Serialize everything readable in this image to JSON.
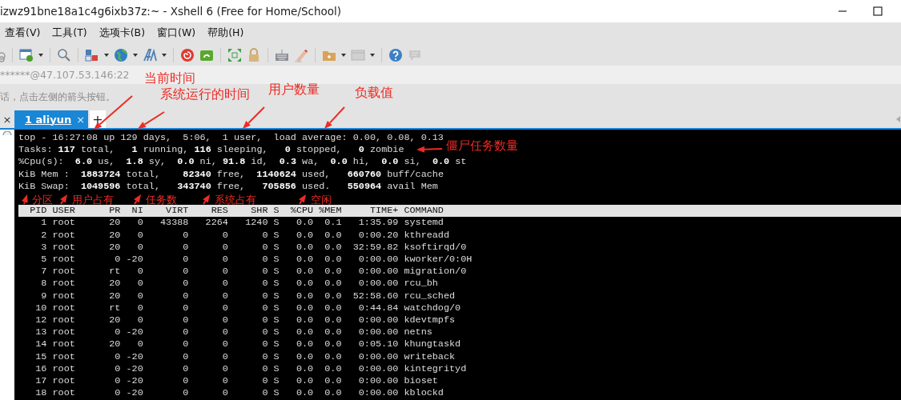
{
  "window": {
    "title": "izwz91bne18a1c4g6ixb37z:~ - Xshell 6 (Free for Home/School)"
  },
  "menu": [
    {
      "label": "查看(V)"
    },
    {
      "label": "工具(T)"
    },
    {
      "label": "选项卡(B)"
    },
    {
      "label": "窗口(W)"
    },
    {
      "label": "帮助(H)"
    }
  ],
  "address_bar": {
    "value": "******@47.107.53.146:22"
  },
  "hint_bar": {
    "text": "话，点击左侧的箭头按钮。"
  },
  "tabs": {
    "leading_close": "×",
    "items": [
      {
        "label": "1 aliyun",
        "selected": true,
        "close": "×"
      }
    ],
    "add": "+"
  },
  "terminal": {
    "summary": [
      "top - 16:27:08 up 129 days,  5:06,  1 user,  load average: 0.00, 0.08, 0.13",
      "Tasks: **117** total,   **1** running, **116** sleeping,   **0** stopped,   **0** zombie",
      "%Cpu(s):  **6.0** us,  **1.8** sy,  **0.0** ni, **91.8** id,  **0.3** wa,  **0.0** hi,  **0.0** si,  **0.0** st",
      "KiB Mem :  **1883724** total,    **82340** free,  **1140624** used,   **660760** buff/cache",
      "KiB Swap:  **1049596** total,   **343740** free,   **705856** used.   **550964** avail Mem"
    ],
    "columns": [
      "PID",
      "USER",
      "PR",
      "NI",
      "VIRT",
      "RES",
      "SHR",
      "S",
      "%CPU",
      "%MEM",
      "TIME+",
      "COMMAND"
    ],
    "rows": [
      [
        "1",
        "root",
        "20",
        "0",
        "43388",
        "2264",
        "1240",
        "S",
        "0.0",
        "0.1",
        "1:35.99",
        "systemd"
      ],
      [
        "2",
        "root",
        "20",
        "0",
        "0",
        "0",
        "0",
        "S",
        "0.0",
        "0.0",
        "0:00.20",
        "kthreadd"
      ],
      [
        "3",
        "root",
        "20",
        "0",
        "0",
        "0",
        "0",
        "S",
        "0.0",
        "0.0",
        "32:59.82",
        "ksoftirqd/0"
      ],
      [
        "5",
        "root",
        "0",
        "-20",
        "0",
        "0",
        "0",
        "S",
        "0.0",
        "0.0",
        "0:00.00",
        "kworker/0:0H"
      ],
      [
        "7",
        "root",
        "rt",
        "0",
        "0",
        "0",
        "0",
        "S",
        "0.0",
        "0.0",
        "0:00.00",
        "migration/0"
      ],
      [
        "8",
        "root",
        "20",
        "0",
        "0",
        "0",
        "0",
        "S",
        "0.0",
        "0.0",
        "0:00.00",
        "rcu_bh"
      ],
      [
        "9",
        "root",
        "20",
        "0",
        "0",
        "0",
        "0",
        "S",
        "0.0",
        "0.0",
        "52:58.60",
        "rcu_sched"
      ],
      [
        "10",
        "root",
        "rt",
        "0",
        "0",
        "0",
        "0",
        "S",
        "0.0",
        "0.0",
        "0:44.84",
        "watchdog/0"
      ],
      [
        "12",
        "root",
        "20",
        "0",
        "0",
        "0",
        "0",
        "S",
        "0.0",
        "0.0",
        "0:00.00",
        "kdevtmpfs"
      ],
      [
        "13",
        "root",
        "0",
        "-20",
        "0",
        "0",
        "0",
        "S",
        "0.0",
        "0.0",
        "0:00.00",
        "netns"
      ],
      [
        "14",
        "root",
        "20",
        "0",
        "0",
        "0",
        "0",
        "S",
        "0.0",
        "0.0",
        "0:05.10",
        "khungtaskd"
      ],
      [
        "15",
        "root",
        "0",
        "-20",
        "0",
        "0",
        "0",
        "S",
        "0.0",
        "0.0",
        "0:00.00",
        "writeback"
      ],
      [
        "16",
        "root",
        "0",
        "-20",
        "0",
        "0",
        "0",
        "S",
        "0.0",
        "0.0",
        "0:00.00",
        "kintegrityd"
      ],
      [
        "17",
        "root",
        "0",
        "-20",
        "0",
        "0",
        "0",
        "S",
        "0.0",
        "0.0",
        "0:00.00",
        "bioset"
      ],
      [
        "18",
        "root",
        "0",
        "-20",
        "0",
        "0",
        "0",
        "S",
        "0.0",
        "0.0",
        "0:00.00",
        "kblockd"
      ]
    ]
  },
  "annotations": [
    {
      "label": "当前时间"
    },
    {
      "label": "系统运行的时间"
    },
    {
      "label": "用户数量"
    },
    {
      "label": "负载值"
    },
    {
      "label": "僵尸任务数量"
    },
    {
      "label": "分区"
    },
    {
      "label": "用户占有"
    },
    {
      "label": "任务数"
    },
    {
      "label": "系统占有"
    },
    {
      "label": "空闲"
    }
  ]
}
